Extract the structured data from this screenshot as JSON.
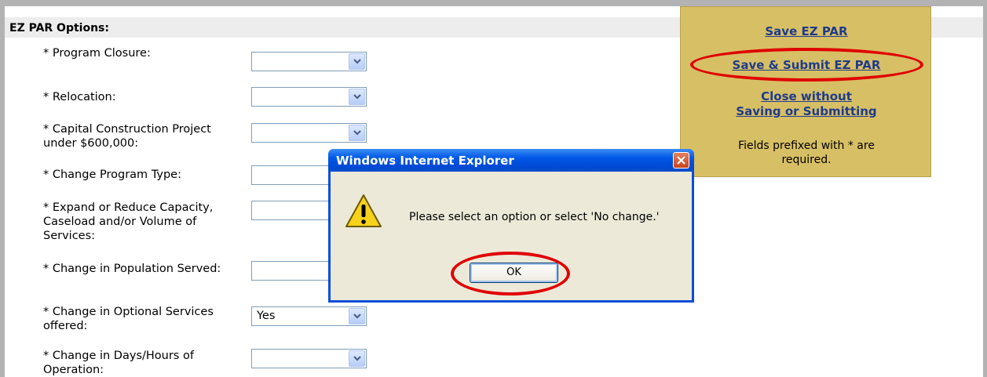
{
  "section": {
    "title": "EZ PAR Options:"
  },
  "fields": [
    {
      "label": "* Program Closure:",
      "value": ""
    },
    {
      "label": "* Relocation:",
      "value": ""
    },
    {
      "label": "* Capital Construction Project under $600,000:",
      "value": ""
    },
    {
      "label": "* Change Program Type:",
      "value": ""
    },
    {
      "label": "* Expand or Reduce Capacity, Caseload and/or Volume of Services:",
      "value": ""
    },
    {
      "label": "* Change in Population Served:",
      "value": ""
    },
    {
      "label": "* Change in Optional Services offered:",
      "value": "Yes"
    },
    {
      "label": "* Change in Days/Hours of Operation:",
      "value": ""
    }
  ],
  "actions": {
    "save": "Save EZ PAR",
    "save_submit": "Save & Submit EZ PAR",
    "close_line1": "Close without",
    "close_line2": "Saving or Submitting",
    "note": "Fields prefixed with * are required."
  },
  "dialog": {
    "title": "Windows Internet Explorer",
    "message": "Please select an option or select 'No change.'",
    "ok_label": "OK",
    "icon": "warning-icon"
  },
  "colors": {
    "panel_bg": "#d7bf65",
    "link": "#1f3b8c",
    "highlight": "#e00000",
    "titlebar": "#0058e6"
  }
}
